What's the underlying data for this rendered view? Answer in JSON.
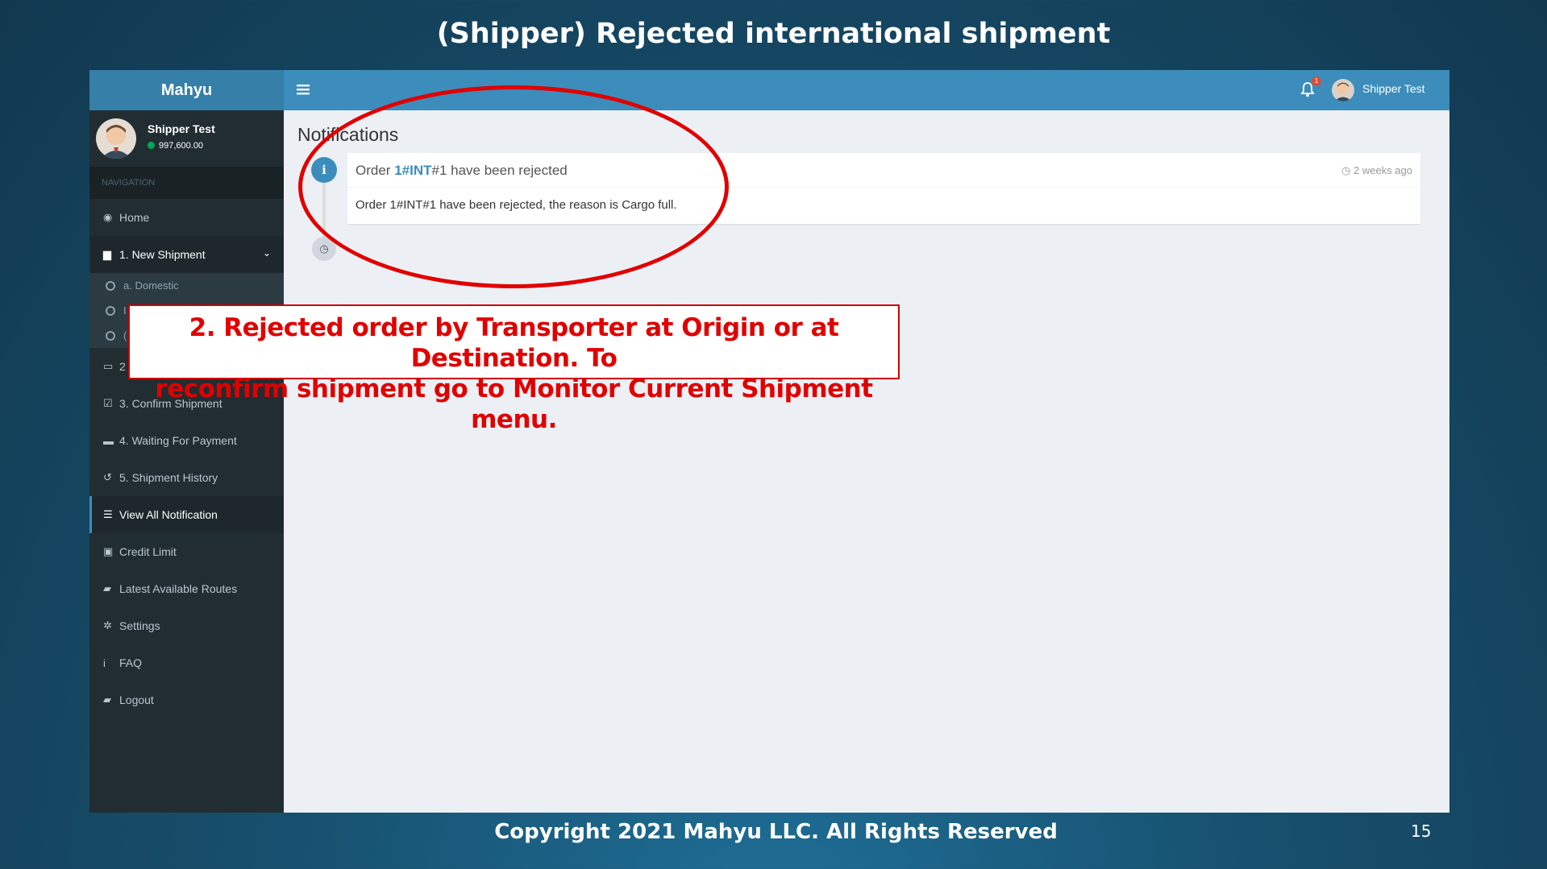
{
  "slide": {
    "title": "(Shipper) Rejected international shipment",
    "footer": "Copyright 2021 Mahyu LLC. All Rights Reserved",
    "page_number": "15"
  },
  "app": {
    "logo": "Mahyu",
    "topbar": {
      "menu_icon": "hamburger-icon",
      "notification_count": "1",
      "user_name": "Shipper Test"
    },
    "sidebar": {
      "user": {
        "name": "Shipper Test",
        "balance": "997,600.00",
        "status_color": "#00a65a"
      },
      "nav_header": "NAVIGATION",
      "items": [
        {
          "label": "Home",
          "icon": "dashboard-icon"
        },
        {
          "label": "1. New Shipment",
          "icon": "file-icon",
          "open": true
        },
        {
          "label": "2",
          "icon": "laptop-icon"
        },
        {
          "label": "3. Confirm Shipment",
          "icon": "check-square-icon"
        },
        {
          "label": "4. Waiting For Payment",
          "icon": "credit-card-icon"
        },
        {
          "label": "5. Shipment History",
          "icon": "history-icon"
        },
        {
          "label": "View All Notification",
          "icon": "list-icon",
          "active": true
        },
        {
          "label": "Credit Limit",
          "icon": "money-icon"
        },
        {
          "label": "Latest Available Routes",
          "icon": "book-icon"
        },
        {
          "label": "Settings",
          "icon": "gear-icon"
        },
        {
          "label": "FAQ",
          "icon": "info-icon"
        },
        {
          "label": "Logout",
          "icon": "book-icon"
        }
      ],
      "subitems": [
        {
          "label": "a. Domestic"
        },
        {
          "label": "I"
        },
        {
          "label": "("
        }
      ]
    },
    "content": {
      "title": "Notifications",
      "notification": {
        "header_prefix": "Order ",
        "header_link": "1#INT",
        "header_suffix": "#1 have been rejected",
        "time": "2 weeks ago",
        "body": "Order 1#INT#1 have been rejected, the reason is Cargo full."
      }
    }
  },
  "annotation": {
    "line1": "2. Rejected order by Transporter at Origin or at Destination. To",
    "line2": "reconfirm shipment go to Monitor Current Shipment menu.",
    "color": "#e00000"
  }
}
